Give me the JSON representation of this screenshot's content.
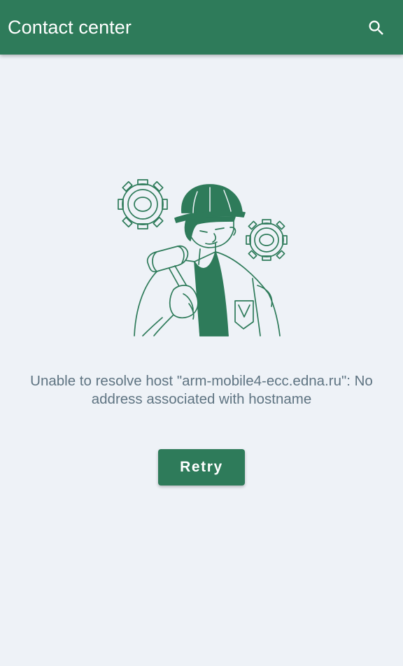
{
  "app_bar": {
    "title": "Contact center",
    "background_color": "#2e7b5a",
    "search_icon": "search-icon"
  },
  "illustration": {
    "name": "worker-with-hammer-and-gears"
  },
  "error": {
    "message": "Unable to resolve host \"arm-mobile4-ecc.edna.ru\": No address associated with hostname",
    "text_color": "#5f7482"
  },
  "retry": {
    "label": "Retry",
    "color": "#2e7b5a"
  },
  "page": {
    "background_color": "#eef2f7"
  }
}
